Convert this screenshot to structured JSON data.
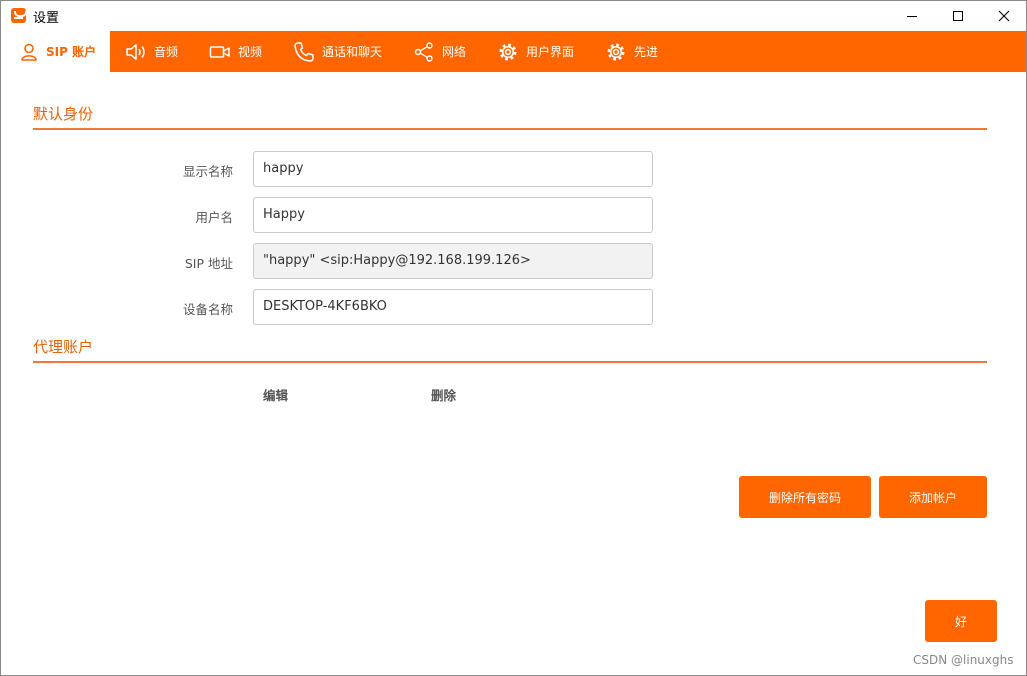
{
  "window": {
    "title": "设置"
  },
  "tabs": [
    {
      "label": "SIP 账户",
      "icon": "user-icon",
      "active": true
    },
    {
      "label": "音频",
      "icon": "speaker-icon",
      "active": false
    },
    {
      "label": "视频",
      "icon": "video-camera-icon",
      "active": false
    },
    {
      "label": "通话和聊天",
      "icon": "phone-icon",
      "active": false
    },
    {
      "label": "网络",
      "icon": "share-network-icon",
      "active": false
    },
    {
      "label": "用户界面",
      "icon": "gear-icon",
      "active": false
    },
    {
      "label": "先进",
      "icon": "gear-icon",
      "active": false
    }
  ],
  "default_identity": {
    "title": "默认身份",
    "fields": [
      {
        "label": "显示名称",
        "value": "happy"
      },
      {
        "label": "用户名",
        "value": "Happy"
      },
      {
        "label": "SIP 地址",
        "value": "\"happy\" <sip:Happy@192.168.199.126>"
      },
      {
        "label": "设备名称",
        "value": "DESKTOP-4KF6BKO"
      }
    ]
  },
  "proxy_accounts": {
    "title": "代理账户",
    "columns": [
      "编辑",
      "删除"
    ]
  },
  "buttons": {
    "delete_passwords": "删除所有密码",
    "add_account": "添加帐户",
    "ok": "好"
  },
  "watermark": "CSDN @linuxghs",
  "colors": {
    "accent": "#ff6600",
    "section_title": "#e8620a"
  }
}
